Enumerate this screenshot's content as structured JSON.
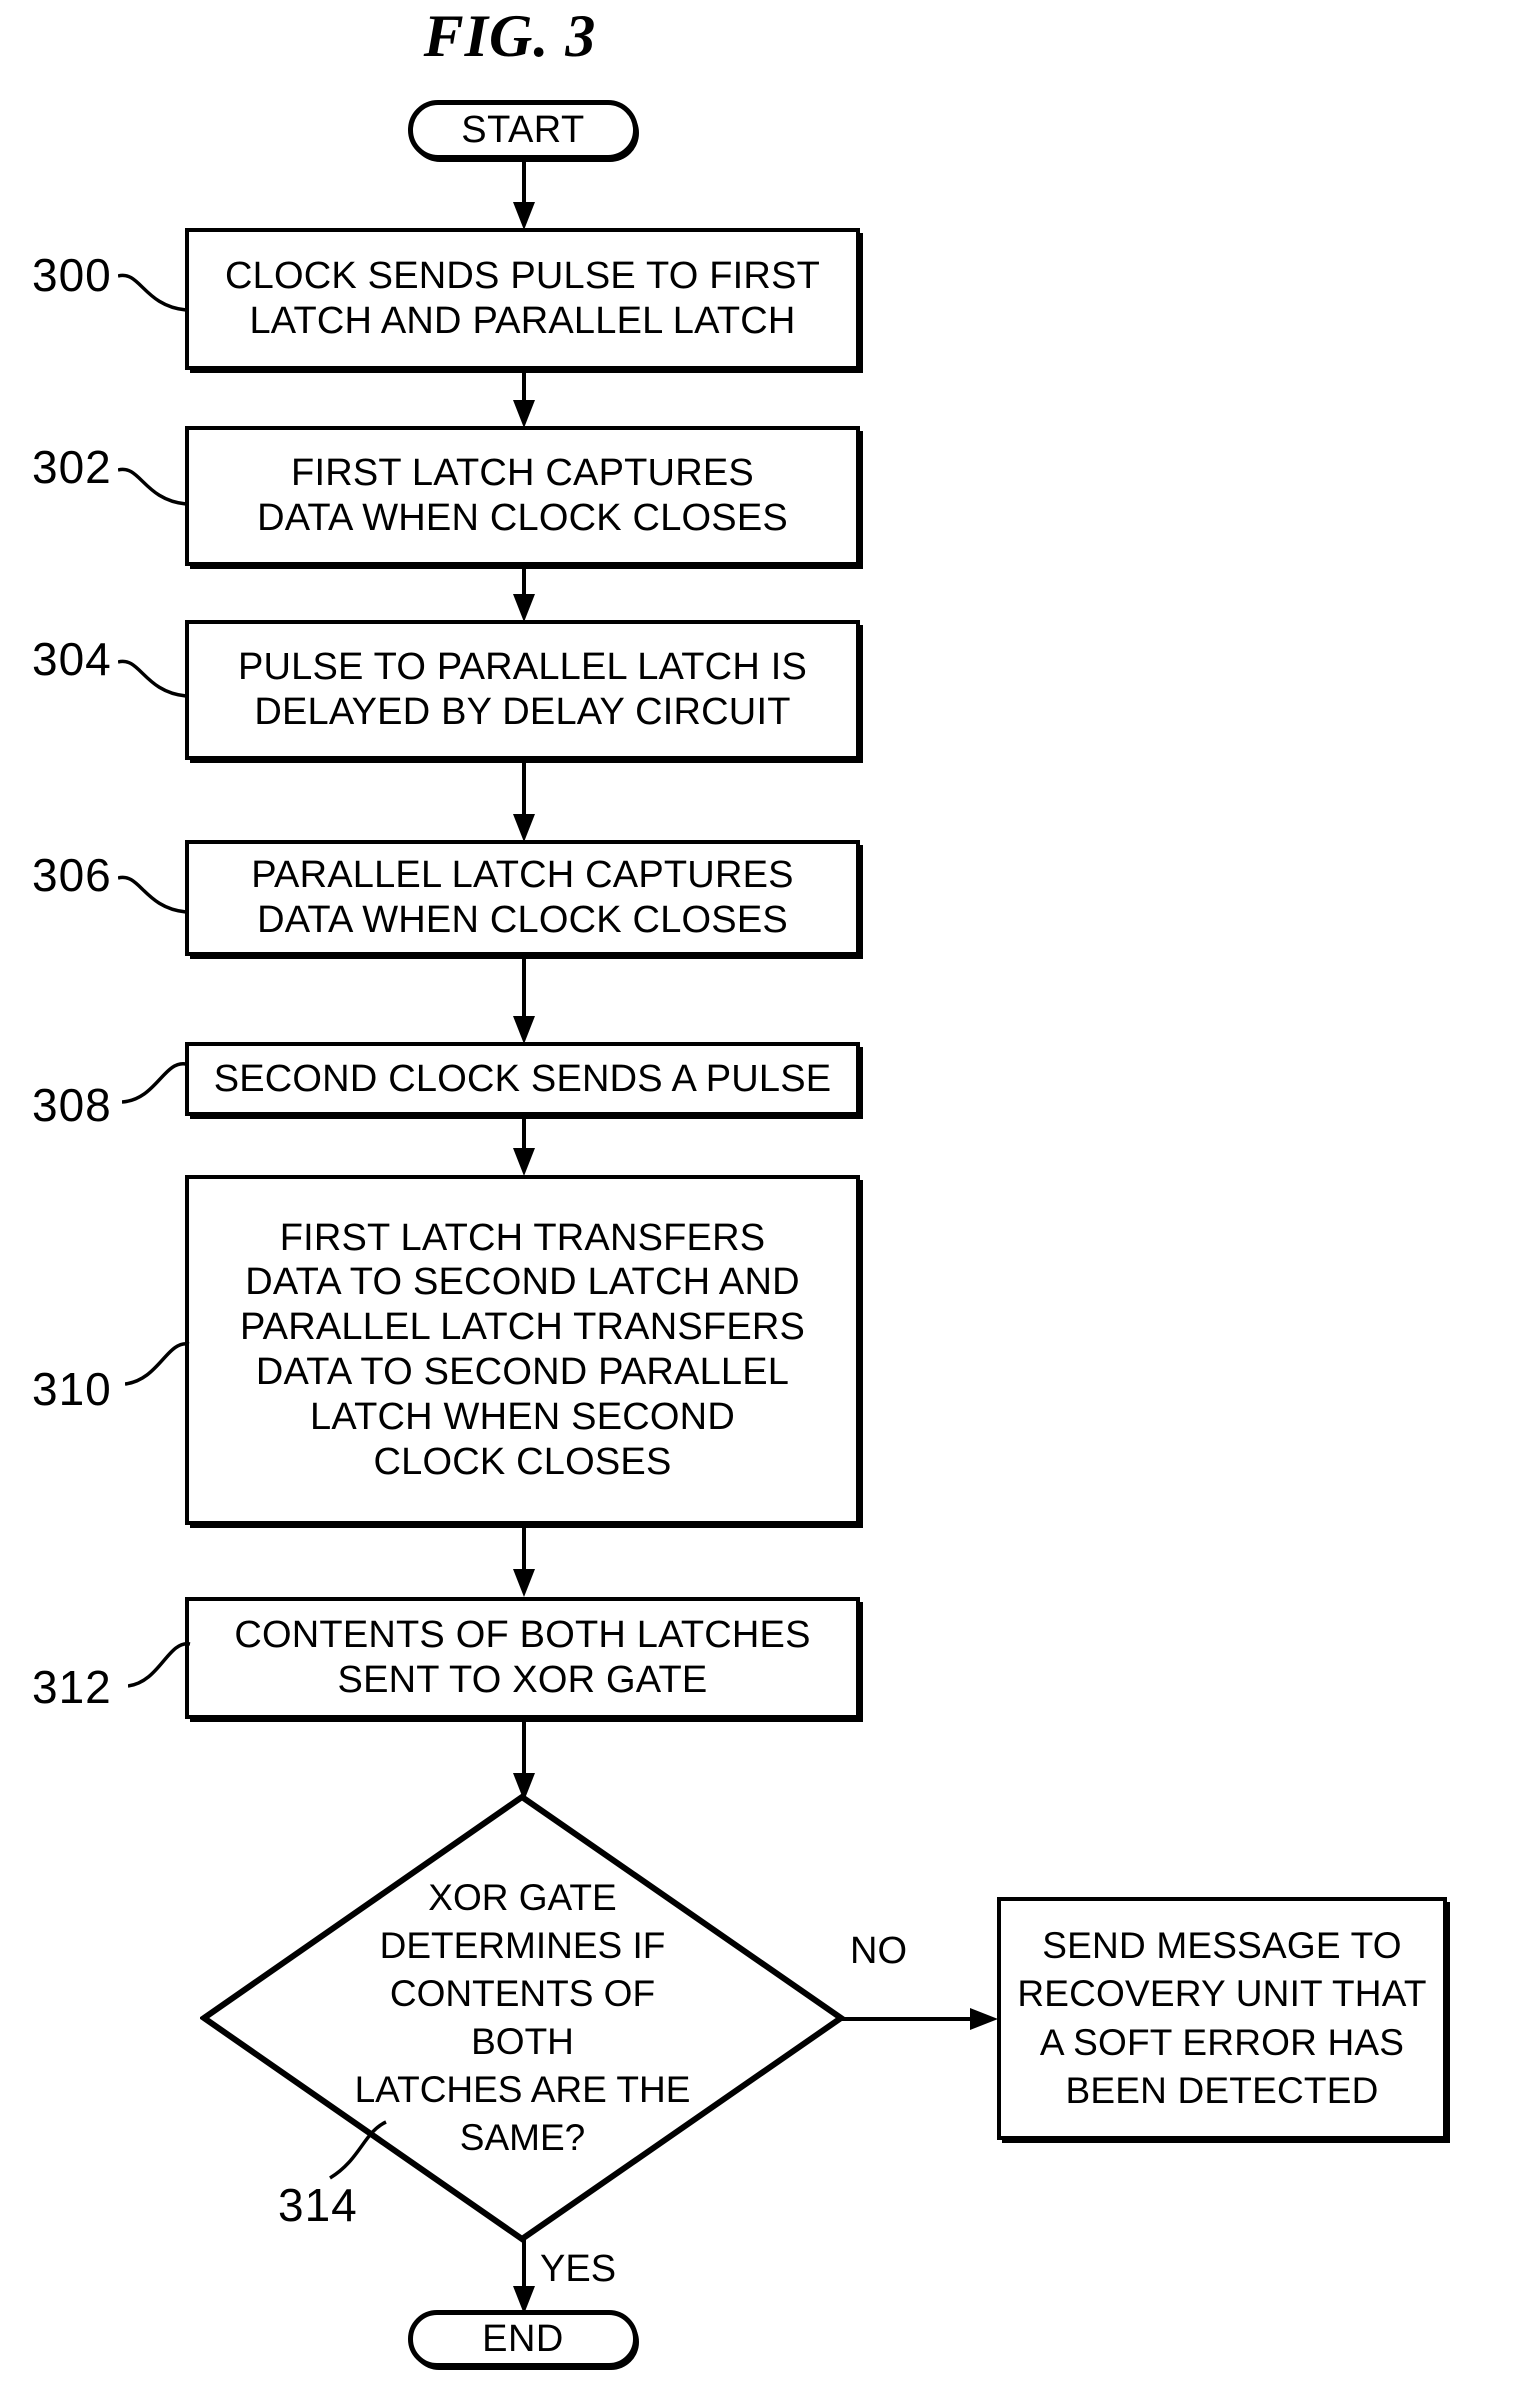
{
  "figure": {
    "title": "FIG. 3"
  },
  "terminators": {
    "start": "START",
    "end": "END"
  },
  "steps": [
    {
      "ref": "300",
      "lines": [
        "CLOCK SENDS PULSE TO FIRST",
        "LATCH AND PARALLEL LATCH"
      ]
    },
    {
      "ref": "302",
      "lines": [
        "FIRST LATCH CAPTURES",
        "DATA WHEN CLOCK CLOSES"
      ]
    },
    {
      "ref": "304",
      "lines": [
        "PULSE TO PARALLEL LATCH IS",
        "DELAYED BY DELAY CIRCUIT"
      ]
    },
    {
      "ref": "306",
      "lines": [
        "PARALLEL LATCH CAPTURES",
        "DATA WHEN CLOCK CLOSES"
      ]
    },
    {
      "ref": "308",
      "lines": [
        "SECOND CLOCK SENDS A PULSE"
      ]
    },
    {
      "ref": "310",
      "lines": [
        "FIRST LATCH TRANSFERS",
        "DATA TO SECOND LATCH AND",
        "PARALLEL LATCH TRANSFERS",
        "DATA TO SECOND PARALLEL",
        "LATCH WHEN SECOND",
        "CLOCK CLOSES"
      ]
    },
    {
      "ref": "312",
      "lines": [
        "CONTENTS OF BOTH LATCHES",
        "SENT TO XOR GATE"
      ]
    }
  ],
  "decision": {
    "ref": "314",
    "lines": [
      "XOR GATE",
      "DETERMINES IF",
      "CONTENTS OF BOTH",
      "LATCHES ARE THE",
      "SAME?"
    ],
    "branch_no": "NO",
    "branch_yes": "YES"
  },
  "error_box": {
    "lines": [
      "SEND MESSAGE TO",
      "RECOVERY UNIT THAT",
      "A SOFT ERROR HAS",
      "BEEN DETECTED"
    ]
  },
  "colors": {
    "ink": "#000000",
    "paper": "#ffffff"
  }
}
